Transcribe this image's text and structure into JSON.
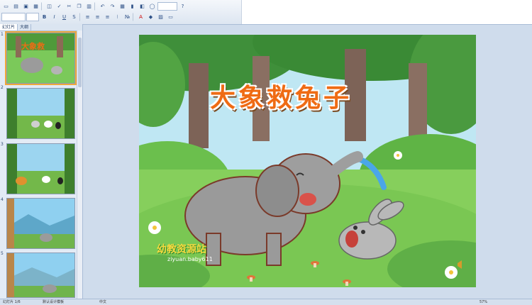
{
  "toolbar": {
    "row1": [
      "new",
      "open",
      "save",
      "print",
      "preview",
      "spell",
      "cut",
      "copy",
      "paste",
      "undo",
      "redo",
      "table",
      "chart",
      "image",
      "shape",
      "zoom",
      "help"
    ],
    "row2_font_size": "",
    "row2": [
      "bold",
      "italic",
      "underline",
      "strike",
      "shadow",
      "align-left",
      "align-center",
      "align-right",
      "bullets",
      "numbering",
      "font-color",
      "fill"
    ]
  },
  "panel": {
    "tabs": [
      "幻灯片",
      "大纲"
    ]
  },
  "slides": [
    {
      "num": "1",
      "selected": true
    },
    {
      "num": "2",
      "selected": false
    },
    {
      "num": "3",
      "selected": false
    },
    {
      "num": "4",
      "selected": false
    },
    {
      "num": "5",
      "selected": false
    }
  ],
  "slide": {
    "title": "大象救兔子",
    "watermark": "幼教资源站",
    "watermark_url": "ziyuan.baby611"
  },
  "status": {
    "left": "幻灯片 1/6",
    "middle": "默认设计模板",
    "right": "中文",
    "zoom": "57%"
  }
}
